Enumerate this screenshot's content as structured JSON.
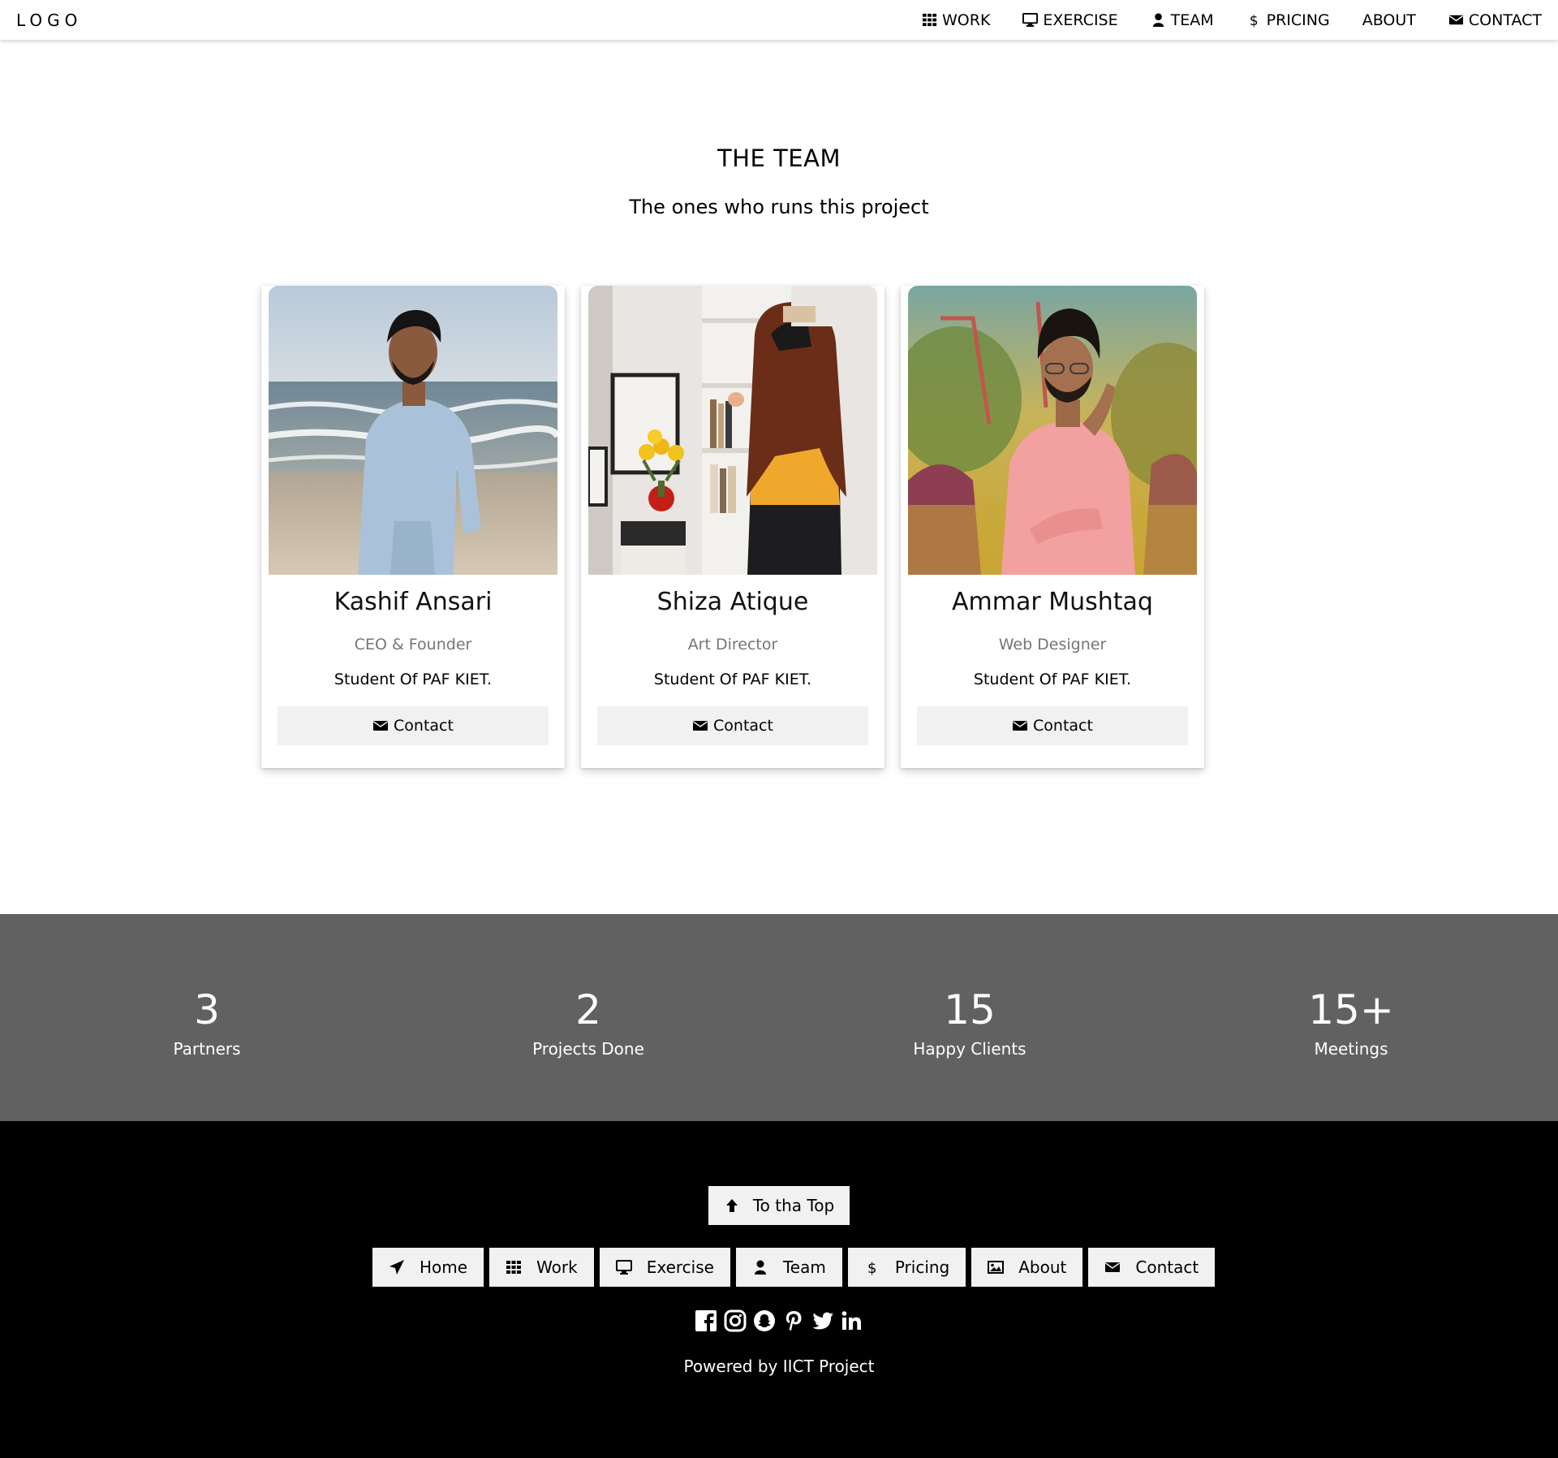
{
  "header": {
    "logo": "LOGO",
    "nav": [
      {
        "label": "WORK",
        "icon": "grid-icon"
      },
      {
        "label": "EXERCISE",
        "icon": "desktop-icon"
      },
      {
        "label": "TEAM",
        "icon": "user-icon"
      },
      {
        "label": "PRICING",
        "icon": "dollar-icon"
      },
      {
        "label": "ABOUT",
        "icon": ""
      },
      {
        "label": "CONTACT",
        "icon": "envelope-icon"
      }
    ]
  },
  "team": {
    "title": "THE TEAM",
    "subtitle": "The ones who runs this project",
    "members": [
      {
        "name": "Kashif Ansari",
        "role": "CEO & Founder",
        "desc": "Student Of PAF KIET.",
        "button": "Contact"
      },
      {
        "name": "Shiza Atique",
        "role": "Art Director",
        "desc": "Student Of PAF KIET.",
        "button": "Contact"
      },
      {
        "name": "Ammar Mushtaq",
        "role": "Web Designer",
        "desc": "Student Of PAF KIET.",
        "button": "Contact"
      }
    ]
  },
  "stats": [
    {
      "value": "3",
      "label": "Partners"
    },
    {
      "value": "2",
      "label": "Projects Done"
    },
    {
      "value": "15",
      "label": "Happy Clients"
    },
    {
      "value": "15+",
      "label": "Meetings"
    }
  ],
  "footer": {
    "top_button": "To tha Top",
    "nav": [
      {
        "label": "Home",
        "icon": "paper-plane-icon"
      },
      {
        "label": "Work",
        "icon": "grid-icon"
      },
      {
        "label": "Exercise",
        "icon": "desktop-icon"
      },
      {
        "label": "Team",
        "icon": "user-icon"
      },
      {
        "label": "Pricing",
        "icon": "dollar-icon"
      },
      {
        "label": "About",
        "icon": "image-icon"
      },
      {
        "label": "Contact",
        "icon": "envelope-icon"
      }
    ],
    "social": [
      "facebook-icon",
      "instagram-icon",
      "snapchat-icon",
      "pinterest-icon",
      "twitter-icon",
      "linkedin-icon"
    ],
    "powered": "Powered by IICT Project"
  },
  "colors": {
    "stats_bg": "#616161",
    "footer_bg": "#000000",
    "button_bg": "#f1f1f1",
    "role_text": "#757575"
  }
}
